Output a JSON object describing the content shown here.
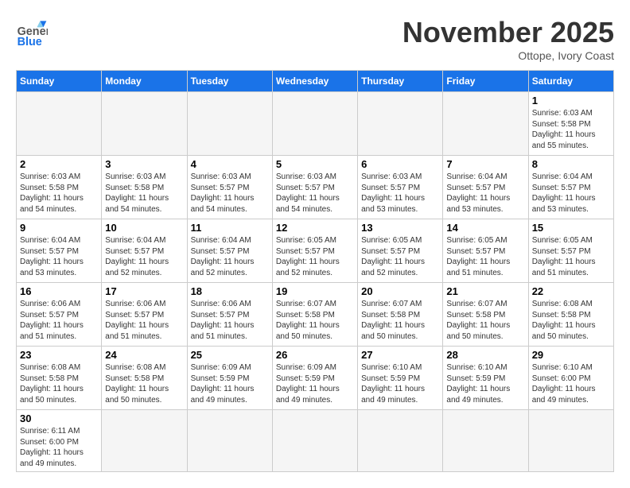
{
  "header": {
    "logo_line1": "General",
    "logo_line2": "Blue",
    "month": "November 2025",
    "location": "Ottope, Ivory Coast"
  },
  "days_of_week": [
    "Sunday",
    "Monday",
    "Tuesday",
    "Wednesday",
    "Thursday",
    "Friday",
    "Saturday"
  ],
  "weeks": [
    [
      {
        "num": "",
        "info": ""
      },
      {
        "num": "",
        "info": ""
      },
      {
        "num": "",
        "info": ""
      },
      {
        "num": "",
        "info": ""
      },
      {
        "num": "",
        "info": ""
      },
      {
        "num": "",
        "info": ""
      },
      {
        "num": "1",
        "info": "Sunrise: 6:03 AM\nSunset: 5:58 PM\nDaylight: 11 hours\nand 55 minutes."
      }
    ],
    [
      {
        "num": "2",
        "info": "Sunrise: 6:03 AM\nSunset: 5:58 PM\nDaylight: 11 hours\nand 54 minutes."
      },
      {
        "num": "3",
        "info": "Sunrise: 6:03 AM\nSunset: 5:58 PM\nDaylight: 11 hours\nand 54 minutes."
      },
      {
        "num": "4",
        "info": "Sunrise: 6:03 AM\nSunset: 5:57 PM\nDaylight: 11 hours\nand 54 minutes."
      },
      {
        "num": "5",
        "info": "Sunrise: 6:03 AM\nSunset: 5:57 PM\nDaylight: 11 hours\nand 54 minutes."
      },
      {
        "num": "6",
        "info": "Sunrise: 6:03 AM\nSunset: 5:57 PM\nDaylight: 11 hours\nand 53 minutes."
      },
      {
        "num": "7",
        "info": "Sunrise: 6:04 AM\nSunset: 5:57 PM\nDaylight: 11 hours\nand 53 minutes."
      },
      {
        "num": "8",
        "info": "Sunrise: 6:04 AM\nSunset: 5:57 PM\nDaylight: 11 hours\nand 53 minutes."
      }
    ],
    [
      {
        "num": "9",
        "info": "Sunrise: 6:04 AM\nSunset: 5:57 PM\nDaylight: 11 hours\nand 53 minutes."
      },
      {
        "num": "10",
        "info": "Sunrise: 6:04 AM\nSunset: 5:57 PM\nDaylight: 11 hours\nand 52 minutes."
      },
      {
        "num": "11",
        "info": "Sunrise: 6:04 AM\nSunset: 5:57 PM\nDaylight: 11 hours\nand 52 minutes."
      },
      {
        "num": "12",
        "info": "Sunrise: 6:05 AM\nSunset: 5:57 PM\nDaylight: 11 hours\nand 52 minutes."
      },
      {
        "num": "13",
        "info": "Sunrise: 6:05 AM\nSunset: 5:57 PM\nDaylight: 11 hours\nand 52 minutes."
      },
      {
        "num": "14",
        "info": "Sunrise: 6:05 AM\nSunset: 5:57 PM\nDaylight: 11 hours\nand 51 minutes."
      },
      {
        "num": "15",
        "info": "Sunrise: 6:05 AM\nSunset: 5:57 PM\nDaylight: 11 hours\nand 51 minutes."
      }
    ],
    [
      {
        "num": "16",
        "info": "Sunrise: 6:06 AM\nSunset: 5:57 PM\nDaylight: 11 hours\nand 51 minutes."
      },
      {
        "num": "17",
        "info": "Sunrise: 6:06 AM\nSunset: 5:57 PM\nDaylight: 11 hours\nand 51 minutes."
      },
      {
        "num": "18",
        "info": "Sunrise: 6:06 AM\nSunset: 5:57 PM\nDaylight: 11 hours\nand 51 minutes."
      },
      {
        "num": "19",
        "info": "Sunrise: 6:07 AM\nSunset: 5:58 PM\nDaylight: 11 hours\nand 50 minutes."
      },
      {
        "num": "20",
        "info": "Sunrise: 6:07 AM\nSunset: 5:58 PM\nDaylight: 11 hours\nand 50 minutes."
      },
      {
        "num": "21",
        "info": "Sunrise: 6:07 AM\nSunset: 5:58 PM\nDaylight: 11 hours\nand 50 minutes."
      },
      {
        "num": "22",
        "info": "Sunrise: 6:08 AM\nSunset: 5:58 PM\nDaylight: 11 hours\nand 50 minutes."
      }
    ],
    [
      {
        "num": "23",
        "info": "Sunrise: 6:08 AM\nSunset: 5:58 PM\nDaylight: 11 hours\nand 50 minutes."
      },
      {
        "num": "24",
        "info": "Sunrise: 6:08 AM\nSunset: 5:58 PM\nDaylight: 11 hours\nand 50 minutes."
      },
      {
        "num": "25",
        "info": "Sunrise: 6:09 AM\nSunset: 5:59 PM\nDaylight: 11 hours\nand 49 minutes."
      },
      {
        "num": "26",
        "info": "Sunrise: 6:09 AM\nSunset: 5:59 PM\nDaylight: 11 hours\nand 49 minutes."
      },
      {
        "num": "27",
        "info": "Sunrise: 6:10 AM\nSunset: 5:59 PM\nDaylight: 11 hours\nand 49 minutes."
      },
      {
        "num": "28",
        "info": "Sunrise: 6:10 AM\nSunset: 5:59 PM\nDaylight: 11 hours\nand 49 minutes."
      },
      {
        "num": "29",
        "info": "Sunrise: 6:10 AM\nSunset: 6:00 PM\nDaylight: 11 hours\nand 49 minutes."
      }
    ],
    [
      {
        "num": "30",
        "info": "Sunrise: 6:11 AM\nSunset: 6:00 PM\nDaylight: 11 hours\nand 49 minutes."
      },
      {
        "num": "",
        "info": ""
      },
      {
        "num": "",
        "info": ""
      },
      {
        "num": "",
        "info": ""
      },
      {
        "num": "",
        "info": ""
      },
      {
        "num": "",
        "info": ""
      },
      {
        "num": "",
        "info": ""
      }
    ]
  ]
}
